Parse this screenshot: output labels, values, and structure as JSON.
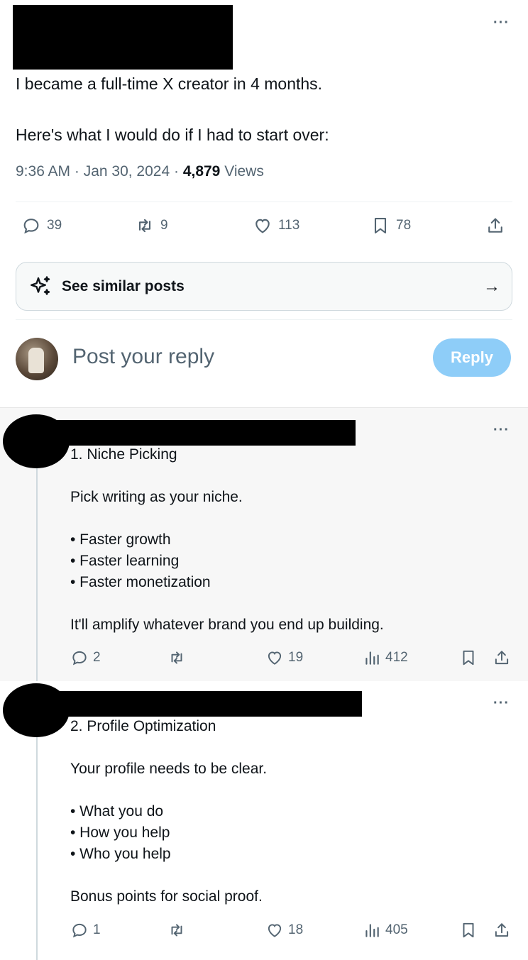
{
  "post": {
    "line1": "I became a full-time X creator in 4 months.",
    "line2": "Here's what I would do if I had to start over:",
    "time": "9:36 AM · Jan 30, 2024 · ",
    "views_count": "4,879",
    "views_label": " Views",
    "more": "···",
    "actions": {
      "replies": "39",
      "reposts": "9",
      "likes": "113",
      "bookmarks": "78"
    }
  },
  "similar": {
    "label": "See similar posts",
    "arrow": "→"
  },
  "composer": {
    "placeholder": "Post your reply",
    "button": "Reply"
  },
  "replies": [
    {
      "more": "···",
      "title": "1. Niche Picking",
      "body1": "Pick writing as your niche.",
      "bullets": [
        "• Faster growth",
        "• Faster learning",
        "• Faster monetization"
      ],
      "body2": "It'll amplify whatever brand you end up building.",
      "stats": {
        "replies": "2",
        "likes": "19",
        "views": "412"
      }
    },
    {
      "more": "···",
      "title": "2. Profile Optimization",
      "body1": "Your profile needs to be clear.",
      "bullets": [
        "• What you do",
        "• How you help",
        "• Who you help"
      ],
      "body2": "Bonus points for social proof.",
      "stats": {
        "replies": "1",
        "likes": "18",
        "views": "405"
      }
    }
  ],
  "colors": {
    "muted": "#536471",
    "reply_button": "#8ecdf8",
    "thread_line": "#cfd9de"
  }
}
